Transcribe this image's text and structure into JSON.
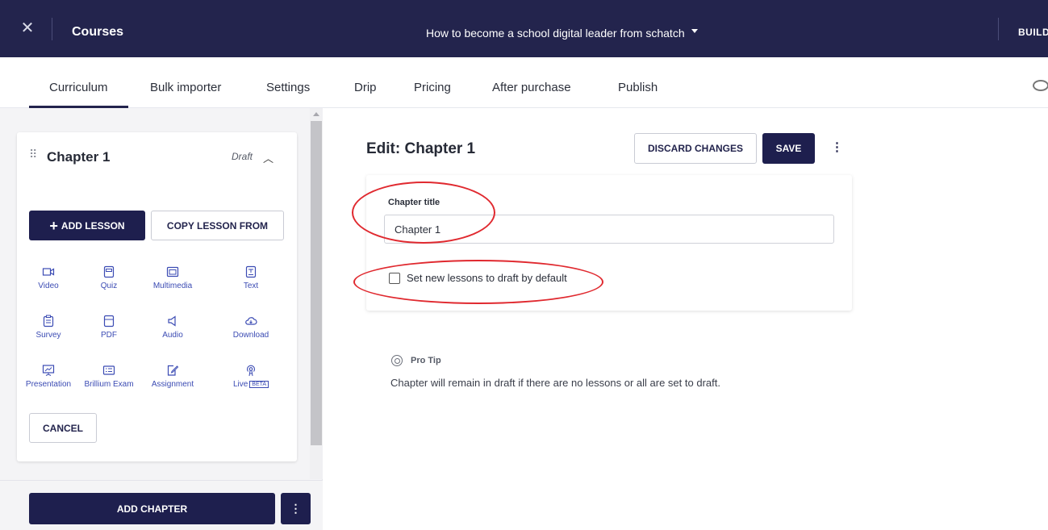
{
  "topbar": {
    "close_glyph": "✕",
    "section": "Courses",
    "course_title": "How to become a school digital leader from schatch",
    "right_action": "BUILD"
  },
  "tabs": [
    {
      "label": "Curriculum",
      "active": true
    },
    {
      "label": "Bulk importer",
      "active": false
    },
    {
      "label": "Settings",
      "active": false
    },
    {
      "label": "Drip",
      "active": false
    },
    {
      "label": "Pricing",
      "active": false
    },
    {
      "label": "After purchase",
      "active": false
    },
    {
      "label": "Publish",
      "active": false
    }
  ],
  "sidebar": {
    "chapter": {
      "name": "Chapter 1",
      "status": "Draft"
    },
    "add_lesson_label": "ADD LESSON",
    "copy_lesson_label": "COPY LESSON FROM",
    "lesson_types": [
      {
        "label": "Video",
        "icon": "video-icon"
      },
      {
        "label": "Quiz",
        "icon": "quiz-icon"
      },
      {
        "label": "Multimedia",
        "icon": "multimedia-icon"
      },
      {
        "label": "Text",
        "icon": "text-icon"
      },
      {
        "label": "Survey",
        "icon": "survey-icon"
      },
      {
        "label": "PDF",
        "icon": "pdf-icon"
      },
      {
        "label": "Audio",
        "icon": "audio-icon"
      },
      {
        "label": "Download",
        "icon": "download-icon"
      },
      {
        "label": "Presentation",
        "icon": "presentation-icon"
      },
      {
        "label": "Brillium Exam",
        "icon": "exam-icon"
      },
      {
        "label": "Assignment",
        "icon": "assignment-icon"
      },
      {
        "label": "Live",
        "icon": "live-icon",
        "badge": "BETA"
      }
    ],
    "cancel_label": "CANCEL",
    "add_chapter_label": "ADD CHAPTER"
  },
  "editor": {
    "heading": "Edit: Chapter 1",
    "discard_label": "DISCARD CHANGES",
    "save_label": "SAVE",
    "chapter_title_label": "Chapter title",
    "chapter_title_value": "Chapter 1",
    "draft_default_label": "Set new lessons to draft by default",
    "draft_default_checked": false
  },
  "pro_tip": {
    "title": "Pro Tip",
    "text": "Chapter will remain in draft if there are no lessons or all are set to draft."
  },
  "colors": {
    "navy": "#23244d",
    "primary_button": "#1e1f4e",
    "icon_blue": "#3b4bb3",
    "annotation_red": "#e0292f"
  }
}
